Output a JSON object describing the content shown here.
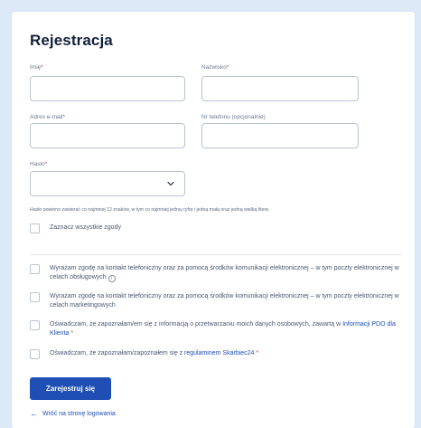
{
  "form": {
    "title": "Rejestracja",
    "first_name": {
      "label": "Imię",
      "required": "*",
      "value": ""
    },
    "last_name": {
      "label": "Nazwisko",
      "required": "*",
      "value": ""
    },
    "email": {
      "label": "Adres e-mail",
      "required": "*",
      "value": ""
    },
    "phone": {
      "label": "Nr telefonu (opcjonalnie)",
      "value": ""
    },
    "password": {
      "label": "Hasło",
      "required": "*",
      "value": ""
    },
    "password_hint": "Hasło powinno zawierać co najmniej 12 znaków, w tym co najmniej jedną cyfrę i jedną małą oraz jedną wielką literę."
  },
  "consents": {
    "select_all": "Zaznacz wszystkie zgody",
    "service": "Wyrażam zgodę na kontakt telefoniczny oraz za pomocą środków komunikacji elektronicznej – w tym poczty elektronicznej w celach obsługowych",
    "info_icon_glyph": "i",
    "marketing": "Wyrażam zgodę na kontakt telefoniczny oraz za pomocą środków komunikacji elektronicznej – w tym poczty elektronicznej w celach marketingowych",
    "privacy_prefix": "Oświadczam, że zapoznałam/em się z informacją o przetwarzaniu moich danych osobowych, zawartą w ",
    "privacy_link": "Informacji PDO dla Klienta",
    "privacy_required": " *",
    "terms_prefix": "Oświadczam, że zapoznałam/zapoznałem się z ",
    "terms_link": "regulaminem Skarbiec24",
    "terms_required": " *"
  },
  "actions": {
    "submit_label": "Zarejestruj się",
    "back_arrow": "←",
    "back_label": "Wróć na stronę logowania"
  },
  "colors": {
    "page_background": "#dce9f6",
    "primary": "#1f4fb4",
    "link": "#1d4fb8",
    "required": "#d93a3a"
  }
}
